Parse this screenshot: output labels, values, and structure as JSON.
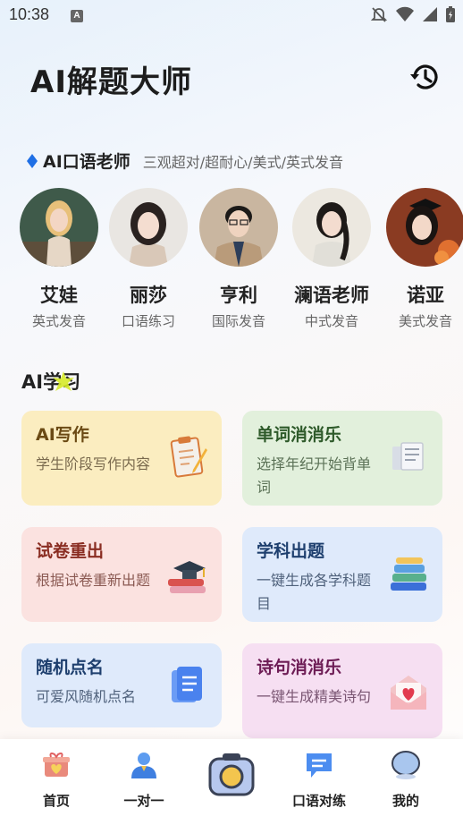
{
  "status": {
    "time": "10:38",
    "app_badge": "A"
  },
  "header": {
    "title": "AI解题大师",
    "history_icon": "history-icon"
  },
  "tutors": {
    "title": "AI口语老师",
    "subtitle": "三观超对/超耐心/美式/英式发音",
    "items": [
      {
        "name": "艾娃",
        "tag": "英式发音"
      },
      {
        "name": "丽莎",
        "tag": "口语练习"
      },
      {
        "name": "亨利",
        "tag": "国际发音"
      },
      {
        "name": "澜语老师",
        "tag": "中式发音"
      },
      {
        "name": "诺亚",
        "tag": "美式发音"
      }
    ]
  },
  "study": {
    "title": "AI学习",
    "cards": [
      {
        "title": "AI写作",
        "desc": "学生阶段写作内容",
        "icon": "clipboard-pencil-icon"
      },
      {
        "title": "单词消消乐",
        "desc": "选择年纪开始背单词",
        "icon": "word-cards-icon"
      },
      {
        "title": "试卷重出",
        "desc": "根据试卷重新出题",
        "icon": "graduation-books-icon"
      },
      {
        "title": "学科出题",
        "desc": "一键生成各学科题目",
        "icon": "book-stack-icon"
      },
      {
        "title": "随机点名",
        "desc": "可爱风随机点名",
        "icon": "document-icon"
      },
      {
        "title": "诗句消消乐",
        "desc": "一键生成精美诗句",
        "icon": "heart-envelope-icon"
      }
    ]
  },
  "nav": {
    "items": [
      {
        "label": "首页",
        "icon": "gift-home-icon"
      },
      {
        "label": "一对一",
        "icon": "person-icon"
      },
      {
        "label": "",
        "icon": "camera-icon"
      },
      {
        "label": "口语对练",
        "icon": "chat-icon"
      },
      {
        "label": "我的",
        "icon": "profile-bubble-icon"
      }
    ]
  },
  "colors": {
    "accent": "#1f6fe5",
    "brand_dark": "#1d1d1d"
  }
}
